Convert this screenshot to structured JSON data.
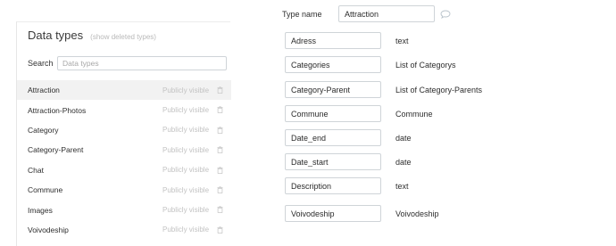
{
  "left_panel": {
    "title": "Data types",
    "show_deleted_label": "(show deleted types)",
    "search_label": "Search",
    "search_placeholder": "Data types",
    "items": [
      {
        "name": "Attraction",
        "visibility": "Publicly visible",
        "selected": true
      },
      {
        "name": "Attraction-Photos",
        "visibility": "Publicly visible"
      },
      {
        "name": "Category",
        "visibility": "Publicly visible"
      },
      {
        "name": "Category-Parent",
        "visibility": "Publicly visible"
      },
      {
        "name": "Chat",
        "visibility": "Publicly visible"
      },
      {
        "name": "Commune",
        "visibility": "Publicly visible"
      },
      {
        "name": "Images",
        "visibility": "Publicly visible"
      },
      {
        "name": "Voivodeship",
        "visibility": "Publicly visible"
      }
    ]
  },
  "type_editor": {
    "type_name_label": "Type name",
    "type_name_value": "Attraction",
    "fields": [
      {
        "name": "Adress",
        "type": "text"
      },
      {
        "name": "Categories",
        "type": "List of Categorys"
      },
      {
        "name": "Category-Parent",
        "type": "List of Category-Parents"
      },
      {
        "name": "Commune",
        "type": "Commune"
      },
      {
        "name": "Date_end",
        "type": "date"
      },
      {
        "name": "Date_start",
        "type": "date"
      },
      {
        "name": "Description",
        "type": "text"
      },
      {
        "name": "Voivodeship",
        "type": "Voivodeship"
      }
    ]
  },
  "icons": {
    "trash": "trash-icon",
    "comment": "comment-bubble-icon"
  },
  "colors": {
    "selected_row": "#f2f2f2",
    "muted_text": "#c3c3c3",
    "input_border": "#cfd4d8"
  }
}
